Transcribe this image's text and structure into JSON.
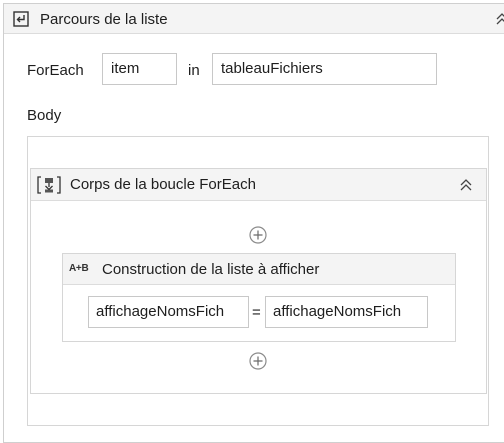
{
  "foreach_activity": {
    "title": "Parcours de la liste",
    "foreach_label": "ForEach",
    "item_value": "item",
    "in_label": "in",
    "collection_value": "tableauFichiers",
    "body_label": "Body",
    "icons": {
      "activity": "foreach-icon",
      "collapse": "double-chevron-up-icon"
    }
  },
  "body_sequence": {
    "title": "Corps de la boucle ForEach",
    "icons": {
      "activity": "body-sequence-icon",
      "collapse": "double-chevron-up-icon",
      "add": "plus-circle-icon"
    }
  },
  "assign_activity": {
    "icon_text": "A+B",
    "title": "Construction de la liste à afficher",
    "left_value": "affichageNomsFich",
    "operator": "=",
    "right_value": "affichageNomsFich"
  }
}
